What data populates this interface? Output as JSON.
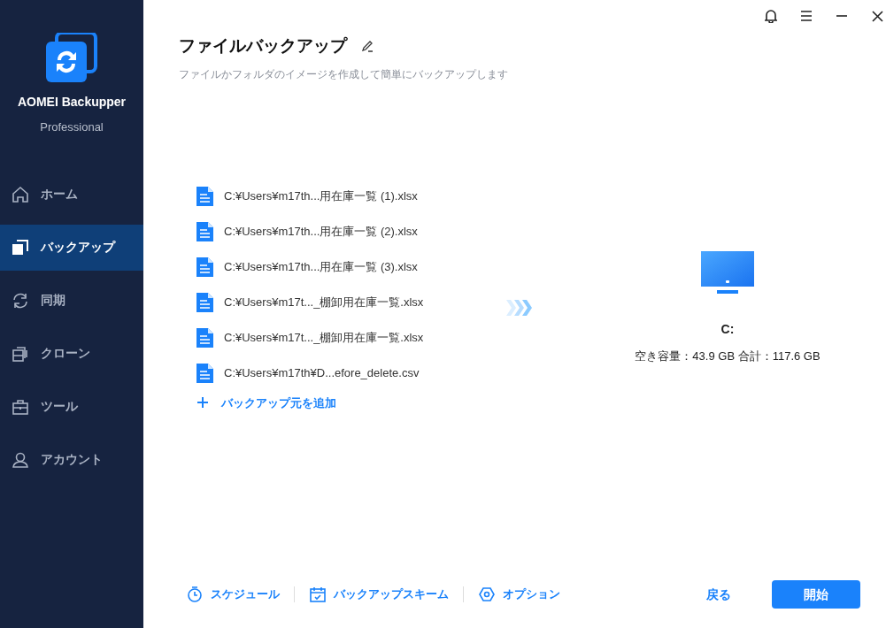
{
  "app": {
    "name": "AOMEI Backupper",
    "edition": "Professional"
  },
  "nav": [
    {
      "label": "ホーム",
      "kind": "home",
      "selected": false
    },
    {
      "label": "バックアップ",
      "kind": "backup",
      "selected": true
    },
    {
      "label": "同期",
      "kind": "sync",
      "selected": false
    },
    {
      "label": "クローン",
      "kind": "clone",
      "selected": false
    },
    {
      "label": "ツール",
      "kind": "tools",
      "selected": false
    },
    {
      "label": "アカウント",
      "kind": "account",
      "selected": false
    }
  ],
  "header": {
    "title": "ファイルバックアップ",
    "subtitle": "ファイルかフォルダのイメージを作成して簡単にバックアップします"
  },
  "sources": [
    "C:¥Users¥m17th...用在庫一覧 (1).xlsx",
    "C:¥Users¥m17th...用在庫一覧 (2).xlsx",
    "C:¥Users¥m17th...用在庫一覧 (3).xlsx",
    "C:¥Users¥m17t..._棚卸用在庫一覧.xlsx",
    "C:¥Users¥m17t..._棚卸用在庫一覧.xlsx",
    "C:¥Users¥m17th¥D...efore_delete.csv"
  ],
  "add_source": "バックアップ元を追加",
  "destination": {
    "name": "C:",
    "space": "空き容量：43.9 GB 合計：117.6 GB"
  },
  "footer": {
    "options": [
      {
        "label": "スケジュール",
        "kind": "schedule"
      },
      {
        "label": "バックアップスキーム",
        "kind": "scheme"
      },
      {
        "label": "オプション",
        "kind": "option"
      }
    ],
    "back": "戻る",
    "start": "開始"
  }
}
